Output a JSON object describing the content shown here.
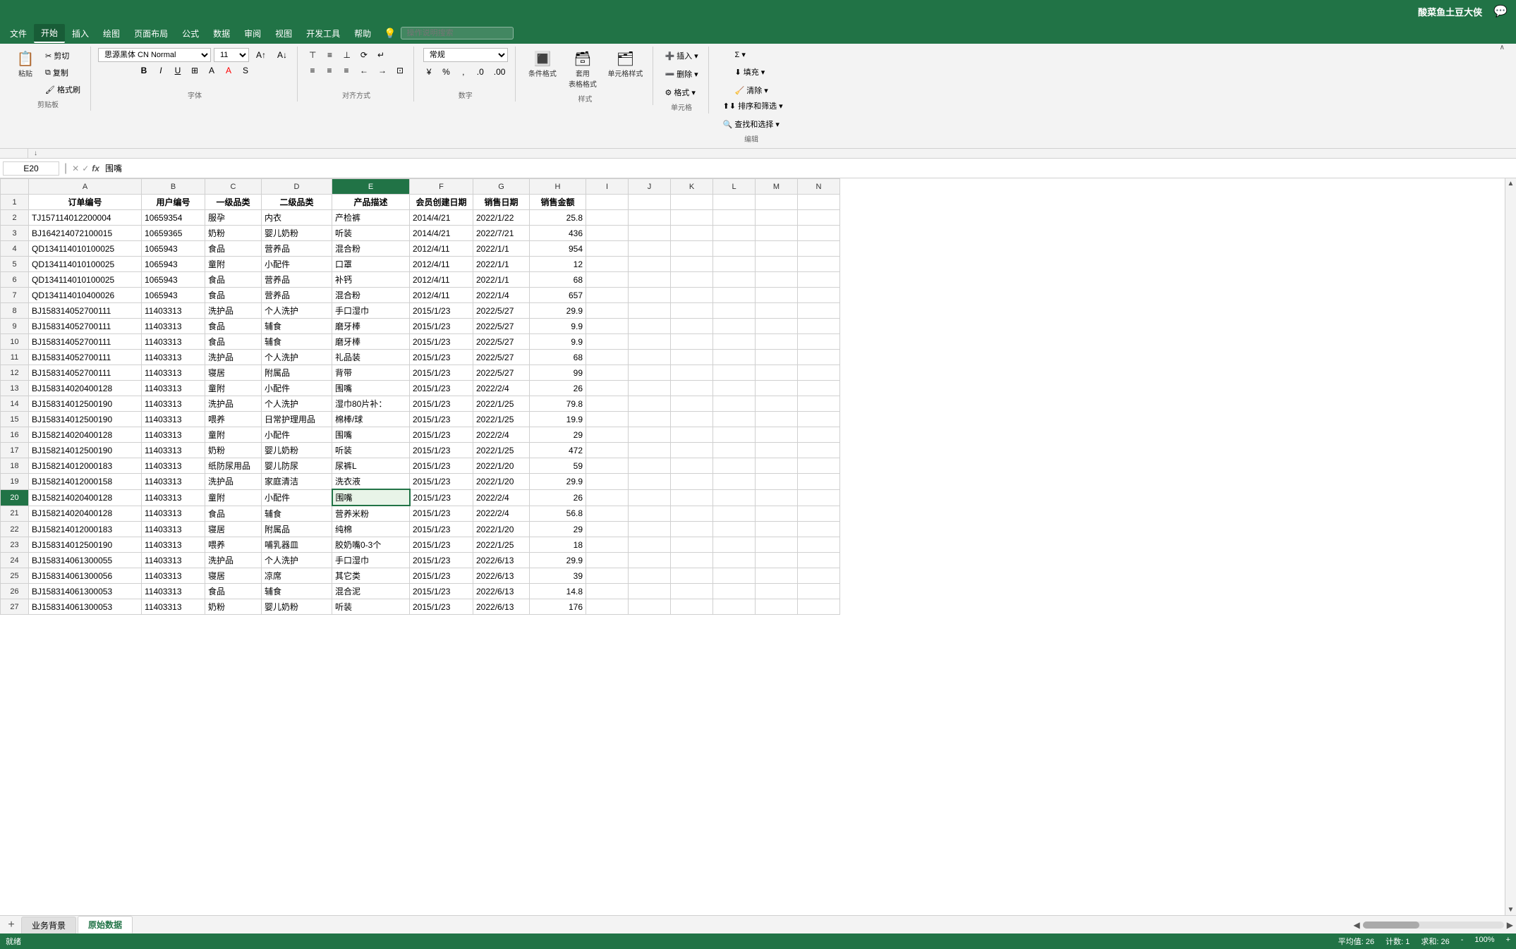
{
  "titlebar": {
    "username": "酸菜鱼土豆大侠",
    "chat_icon": "💬"
  },
  "menubar": {
    "items": [
      "文件",
      "开始",
      "插入",
      "绘图",
      "页面布局",
      "公式",
      "数据",
      "审阅",
      "视图",
      "开发工具",
      "帮助"
    ],
    "active": "开始",
    "search_placeholder": "操作说明搜索"
  },
  "ribbon": {
    "clipboard": {
      "label": "剪贴板",
      "paste": "粘贴",
      "cut": "✂",
      "copy": "⧉",
      "format_painter": "🖌"
    },
    "font": {
      "label": "字体",
      "font_name": "思源黑体 CN Normal",
      "font_size": "11",
      "bold": "B",
      "italic": "I",
      "underline": "U",
      "border": "⊞",
      "fill_color": "A",
      "font_color": "A",
      "increase_font": "A↑",
      "decrease_font": "A↓"
    },
    "alignment": {
      "label": "对齐方式",
      "top_align": "⊤",
      "middle_align": "≡",
      "bottom_align": "⊥",
      "left_align": "≡",
      "center_align": "≡",
      "right_align": "≡",
      "wrap_text": "↵",
      "merge_center": "⊡",
      "indent_decrease": "←",
      "indent_increase": "→",
      "orientation": "⟳"
    },
    "number": {
      "label": "数字",
      "format": "常规",
      "percent": "%",
      "thousand": ",",
      "increase_decimal": ".0",
      "decrease_decimal": ".00",
      "currency": "¥",
      "accounting": "⊠"
    },
    "styles": {
      "label": "样式",
      "conditional_format": "条件格式",
      "table_format": "套用\n表格格式",
      "cell_styles": "单元格样式"
    },
    "cells": {
      "label": "单元格",
      "insert": "插入",
      "delete": "删除",
      "format": "格式"
    },
    "editing": {
      "label": "编辑",
      "sum": "Σ",
      "sort_filter": "排序和筛选",
      "find_select": "查找和选择",
      "fill": "⬇",
      "clear": "🧹"
    }
  },
  "formulabar": {
    "cell_ref": "E20",
    "formula": "围嘴"
  },
  "columns": {
    "row_header": "",
    "headers": [
      "A",
      "B",
      "C",
      "D",
      "E",
      "F",
      "G",
      "H",
      "I",
      "J",
      "K",
      "L",
      "M",
      "N"
    ]
  },
  "data": {
    "headers": [
      "订单编号",
      "用户编号",
      "一级品类",
      "二级品类",
      "产品描述",
      "会员创建日期",
      "销售日期",
      "销售金额"
    ],
    "rows": [
      [
        "TJ157114012200004",
        "10659354",
        "服孕",
        "内衣",
        "产检裤",
        "2014/4/21",
        "2022/1/22",
        "25.8"
      ],
      [
        "BJ164214072100015",
        "10659365",
        "奶粉",
        "婴儿奶粉",
        "听装",
        "2014/4/21",
        "2022/7/21",
        "436"
      ],
      [
        "QD134114010100025",
        "1065943",
        "食品",
        "营养品",
        "混合粉",
        "2012/4/11",
        "2022/1/1",
        "954"
      ],
      [
        "QD134114010100025",
        "1065943",
        "童附",
        "小配件",
        "口罩",
        "2012/4/11",
        "2022/1/1",
        "12"
      ],
      [
        "QD134114010100025",
        "1065943",
        "食品",
        "营养品",
        "补钙",
        "2012/4/11",
        "2022/1/1",
        "68"
      ],
      [
        "QD134114010400026",
        "1065943",
        "食品",
        "营养品",
        "混合粉",
        "2012/4/11",
        "2022/1/4",
        "657"
      ],
      [
        "BJ158314052700111",
        "11403313",
        "洗护品",
        "个人洗护",
        "手口湿巾",
        "2015/1/23",
        "2022/5/27",
        "29.9"
      ],
      [
        "BJ158314052700111",
        "11403313",
        "食品",
        "辅食",
        "磨牙棒",
        "2015/1/23",
        "2022/5/27",
        "9.9"
      ],
      [
        "BJ158314052700111",
        "11403313",
        "食品",
        "辅食",
        "磨牙棒",
        "2015/1/23",
        "2022/5/27",
        "9.9"
      ],
      [
        "BJ158314052700111",
        "11403313",
        "洗护品",
        "个人洗护",
        "礼品装",
        "2015/1/23",
        "2022/5/27",
        "68"
      ],
      [
        "BJ158314052700111",
        "11403313",
        "寝居",
        "附属品",
        "背带",
        "2015/1/23",
        "2022/5/27",
        "99"
      ],
      [
        "BJ158314020400128",
        "11403313",
        "童附",
        "小配件",
        "围嘴",
        "2015/1/23",
        "2022/2/4",
        "26"
      ],
      [
        "BJ158314012500190",
        "11403313",
        "洗护品",
        "个人洗护",
        "湿巾80片补：",
        "2015/1/23",
        "2022/1/25",
        "79.8"
      ],
      [
        "BJ158314012500190",
        "11403313",
        "喂养",
        "日常护理用品",
        "棉棒/球",
        "2015/1/23",
        "2022/1/25",
        "19.9"
      ],
      [
        "BJ158214020400128",
        "11403313",
        "童附",
        "小配件",
        "围嘴",
        "2015/1/23",
        "2022/2/4",
        "29"
      ],
      [
        "BJ158214012500190",
        "11403313",
        "奶粉",
        "婴儿奶粉",
        "听装",
        "2015/1/23",
        "2022/1/25",
        "472"
      ],
      [
        "BJ158214012000183",
        "11403313",
        "纸防尿用品",
        "婴儿防尿",
        "尿裤L",
        "2015/1/23",
        "2022/1/20",
        "59"
      ],
      [
        "BJ158214012000158",
        "11403313",
        "洗护品",
        "家庭清洁",
        "洗衣液",
        "2015/1/23",
        "2022/1/20",
        "29.9"
      ],
      [
        "BJ158214020400128",
        "11403313",
        "童附",
        "小配件",
        "围嘴",
        "2015/1/23",
        "2022/2/4",
        "26"
      ],
      [
        "BJ158214020400128",
        "11403313",
        "食品",
        "辅食",
        "营养米粉",
        "2015/1/23",
        "2022/2/4",
        "56.8"
      ],
      [
        "BJ158214012000183",
        "11403313",
        "寝居",
        "附属品",
        "纯棉",
        "2015/1/23",
        "2022/1/20",
        "29"
      ],
      [
        "BJ158314012500190",
        "11403313",
        "喂养",
        "哺乳器皿",
        "胶奶嘴0-3个",
        "2015/1/23",
        "2022/1/25",
        "18"
      ],
      [
        "BJ158314061300055",
        "11403313",
        "洗护品",
        "个人洗护",
        "手口湿巾",
        "2015/1/23",
        "2022/6/13",
        "29.9"
      ],
      [
        "BJ158314061300056",
        "11403313",
        "寝居",
        "凉席",
        "其它类",
        "2015/1/23",
        "2022/6/13",
        "39"
      ],
      [
        "BJ158314061300053",
        "11403313",
        "食品",
        "辅食",
        "混合泥",
        "2015/1/23",
        "2022/6/13",
        "14.8"
      ],
      [
        "BJ158314061300053",
        "11403313",
        "奶粉",
        "婴儿奶粉",
        "听装",
        "2015/1/23",
        "2022/6/13",
        "176"
      ]
    ]
  },
  "selected_cell": {
    "ref": "E20",
    "row": 20,
    "col": "E"
  },
  "sheet_tabs": [
    "业务背景",
    "原始数据"
  ],
  "active_tab": "原始数据",
  "status_bar": {
    "items": [
      "平均值: 26",
      "计数: 1",
      "求和: 26"
    ]
  }
}
